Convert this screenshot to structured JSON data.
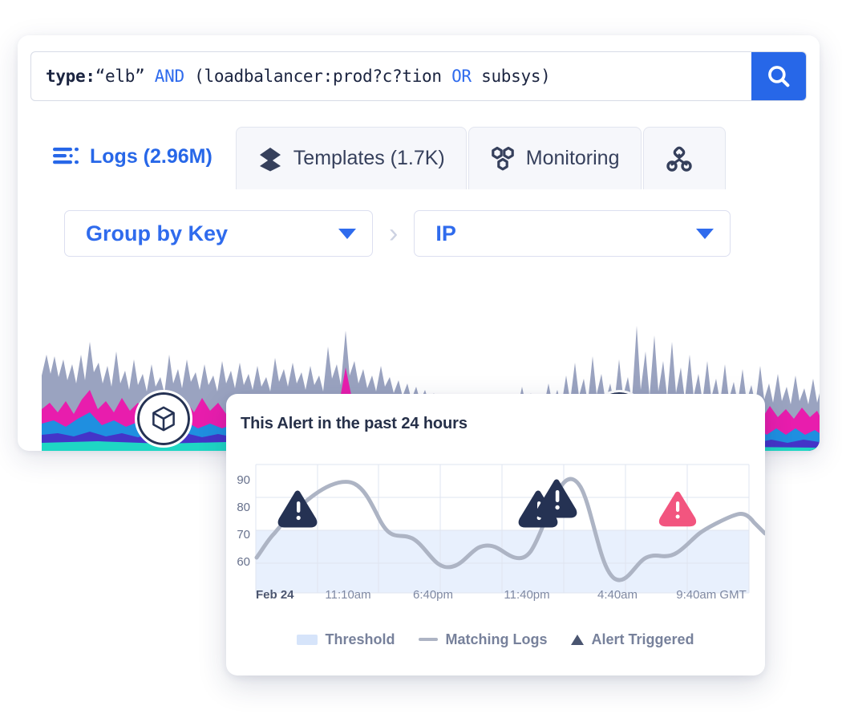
{
  "search": {
    "query_tokens": [
      {
        "t": "type:",
        "c": "key"
      },
      {
        "t": "“elb” ",
        "c": "str"
      },
      {
        "t": "AND ",
        "c": "op"
      },
      {
        "t": "(loadbalancer:prod?c?tion ",
        "c": "plain"
      },
      {
        "t": "OR ",
        "c": "op"
      },
      {
        "t": "subsys)",
        "c": "plain"
      }
    ],
    "query_text": "type:“elb” AND (loadbalancer:prod?c?tion OR subsys)",
    "button_icon": "search-icon"
  },
  "tabs": [
    {
      "label": "Logs (2.96M)",
      "icon": "logs-list-icon",
      "active": true
    },
    {
      "label": "Templates (1.7K)",
      "icon": "layers-stack-icon",
      "active": false
    },
    {
      "label": "Monitoring",
      "icon": "hex-nodes-icon",
      "active": false
    },
    {
      "label": "",
      "icon": "hierarchy-nodes-icon",
      "active": false
    }
  ],
  "groupbar": {
    "key_select": "Group by Key",
    "value_select": "IP",
    "separator": "›"
  },
  "badges": [
    {
      "icon": "cube-icon"
    },
    {
      "icon": "chevron-up-icon"
    }
  ],
  "alert_card": {
    "title": "This Alert in the past 24 hours"
  },
  "chart_data": {
    "type": "line",
    "title": "This Alert in the past 24 hours",
    "xlabel": "",
    "ylabel": "",
    "ylim": [
      48,
      98
    ],
    "yticks": [
      60,
      70,
      80,
      90
    ],
    "grid": true,
    "legend_position": "bottom",
    "xtick_labels": [
      "Feb 24",
      "11:10am",
      "6:40pm",
      "11:40pm",
      "4:40am",
      "9:40am GMT"
    ],
    "threshold": 70,
    "threshold_label": "Threshold",
    "series": [
      {
        "name": "Matching Logs",
        "color": "#adb4c4",
        "x": [
          0,
          2,
          4,
          6,
          8,
          10,
          12,
          14,
          16,
          18,
          20,
          22,
          24,
          26,
          28,
          30,
          32,
          34,
          36,
          38,
          40,
          42,
          44,
          46,
          48,
          50,
          52,
          54,
          56,
          58,
          60,
          62,
          64,
          66,
          68,
          70,
          72,
          74,
          76,
          78,
          80,
          82,
          84,
          86,
          88,
          90,
          92,
          94,
          96,
          98,
          100
        ],
        "values": [
          62,
          67,
          76,
          80,
          83,
          85,
          87,
          89,
          91,
          93,
          94,
          93,
          90,
          85,
          80,
          75,
          72,
          72,
          71,
          68,
          65,
          62,
          61,
          61,
          63,
          65,
          67,
          68,
          69,
          68,
          67,
          66,
          65,
          64,
          65,
          70,
          77,
          84,
          88,
          87,
          80,
          70,
          60,
          55,
          54,
          55,
          59,
          63,
          64,
          64,
          65
        ]
      }
    ],
    "series_tail": {
      "x": [
        72,
        76,
        80,
        84,
        88,
        92,
        96,
        100
      ],
      "values": [
        66,
        68,
        70,
        71,
        74,
        80,
        81,
        77
      ]
    },
    "legend": [
      {
        "label": "Threshold",
        "marker": "band",
        "color": "#d6e4fa"
      },
      {
        "label": "Matching Logs",
        "marker": "line",
        "color": "#adb4c4"
      },
      {
        "label": "Alert Triggered",
        "marker": "triangle",
        "color": "#4a5570"
      }
    ],
    "alert_markers": [
      {
        "x_pct": 9,
        "value": 80,
        "severity": "dark",
        "label": "Alert Triggered"
      },
      {
        "x_pct": 55,
        "value": 82,
        "severity": "dark",
        "label": "Alert Triggered"
      },
      {
        "x_pct": 58,
        "value": 86,
        "severity": "dark",
        "label": "Alert Triggered"
      },
      {
        "x_pct": 85,
        "value": 80,
        "severity": "critical",
        "label": "Alert Triggered"
      }
    ]
  },
  "stream_chart": {
    "type": "area",
    "description": "stacked log volume over time",
    "layers": [
      {
        "name": "other",
        "color": "#9aa3c0"
      },
      {
        "name": "magenta",
        "color": "#e81dad"
      },
      {
        "name": "blue",
        "color": "#1f8fe0"
      },
      {
        "name": "indigo",
        "color": "#4434c8"
      },
      {
        "name": "teal",
        "color": "#1ed6c4"
      }
    ]
  },
  "colors": {
    "accent": "#2767e8",
    "tab_active_text": "#2767e8",
    "text_dark": "#263049",
    "threshold_band": "#d6e4fa",
    "line": "#adb4c4",
    "alert_dark": "#253253",
    "alert_critical": "#f2557f"
  }
}
